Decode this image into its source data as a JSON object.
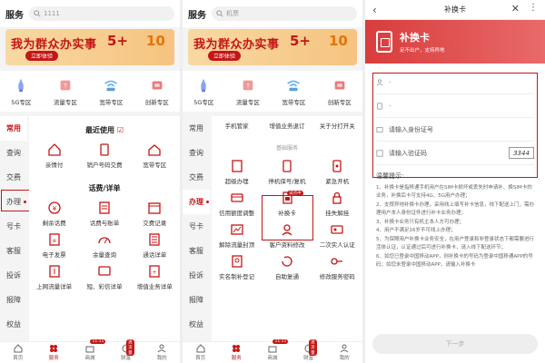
{
  "panel1": {
    "status_title": "服务",
    "search_placeholder": "1111",
    "banner": {
      "title": "我为群众办实事",
      "button": "立即体验",
      "num1": "5+",
      "num2": "10"
    },
    "zones": [
      "5G专区",
      "流量专区",
      "宽带专区",
      "创新专区"
    ],
    "side": [
      "常用",
      "查询",
      "交费",
      "办理",
      "号卡",
      "客服",
      "投诉",
      "报障",
      "权益"
    ],
    "section_recent": "最近使用",
    "recent": [
      "亲情付",
      "销户号码交费",
      "宽带专区"
    ],
    "section_fee": "话费/详单",
    "fee": [
      "剩余话费",
      "话费与账单",
      "交费记录",
      "电子发票",
      "余量查询",
      "通话详单",
      "上网流量详单",
      "短、彩信详单",
      "增值业务详单"
    ]
  },
  "panel2": {
    "status_title": "服务",
    "search_placeholder": "机票",
    "banner": {
      "title": "我为群众办实事",
      "button": "立即体验",
      "num1": "5+",
      "num2": "10"
    },
    "zones": [
      "5G专区",
      "流量专区",
      "宽带专区",
      "创新专区"
    ],
    "side": [
      "常用",
      "查询",
      "交费",
      "办理",
      "号卡",
      "客服",
      "投诉",
      "报障",
      "权益"
    ],
    "partial_row": [
      "手机管家",
      "增值业务退订",
      "关于分打开关"
    ],
    "section_basic": "基础服务",
    "basic": [
      "超级办理",
      "停机保号/复机",
      "紧急开机",
      "信用额度调整",
      "补换卡",
      "挂失解挂",
      "解除流量封顶",
      "客户资料修改",
      "二次实人认证",
      "实名制补登记",
      "自助复通",
      "修改服务密码"
    ],
    "new_badge": "试点中"
  },
  "tabbar": {
    "items": [
      "首页",
      "服务",
      "商城",
      "财富",
      "我的"
    ],
    "badge_mall": "11·11",
    "badge_wealth": "送流量"
  },
  "panel3": {
    "header_title": "补换卡",
    "hero_title": "补换卡",
    "hero_sub": "足不出户，支持异地",
    "field_name": "·",
    "field_phone": "·",
    "field_id": "请输入身份证号",
    "field_code": "请输入验证码",
    "captcha": "3344",
    "tips_title": "温馨提示:",
    "tips": [
      "1、补换卡是指移通手机用户在SIM卡损坏或丢失时申请补、换SIM卡的业务，补换后卡可支持4G、5G用户办理；",
      "2、支撑异地补换卡办理，采用线上填写补卡信息，线下配送上门，需办理用户本人身份证件进行补卡业务办理；",
      "3、补换卡业务只有机主本人方可办理；",
      "4、用户不满足16岁不可线上办理；",
      "5、为保障用户补换卡业务安全，在用户登录和非登录状态下都需要进行活体认证，认证通过后可进行补换卡，请入线下配送环节；",
      "6、如您已登录中国移动APP，则补换卡的号码为登录中国移通APP的号码；如您未登录中国移动APP，请输入补换卡"
    ],
    "next_button": "下一步"
  }
}
